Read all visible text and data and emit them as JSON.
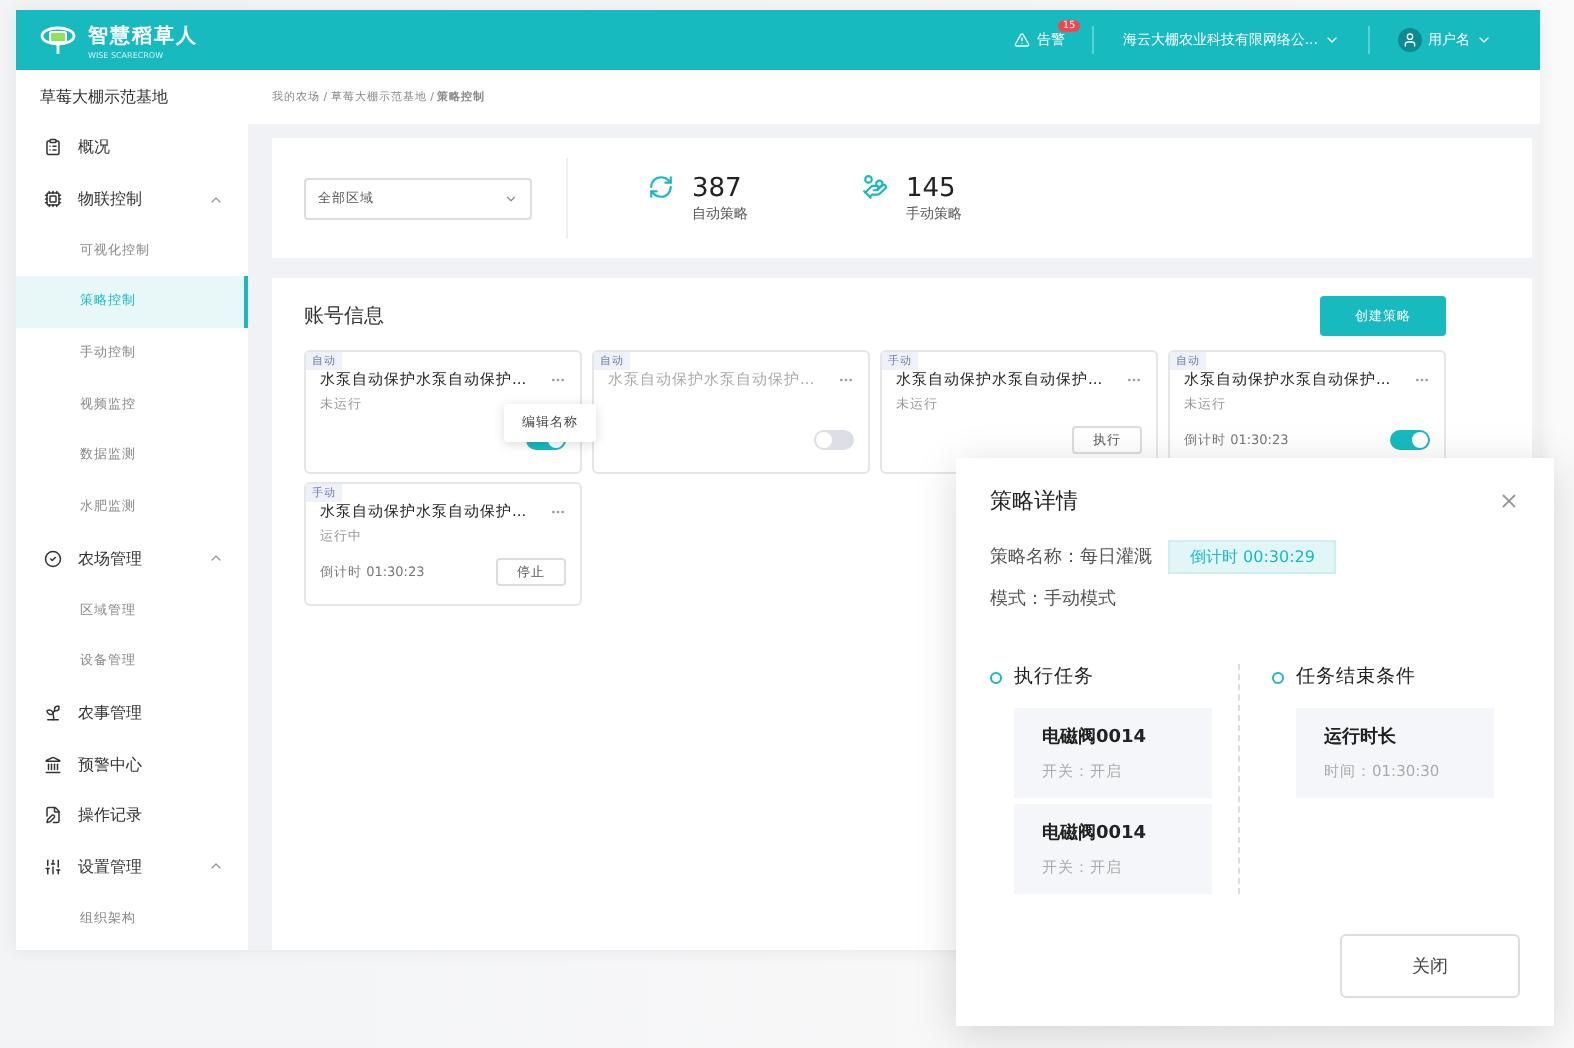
{
  "header": {
    "brand": "智慧稻草人",
    "brand_sub": "WISE SCARECROW",
    "alert": {
      "label": "告警",
      "badge": "15"
    },
    "company": "海云大棚农业科技有限网络公...",
    "user": "用户名"
  },
  "sidebar": {
    "farm": "草莓大棚示范基地",
    "items": [
      {
        "label": "概况"
      },
      {
        "label": "物联控制",
        "expanded": true,
        "children": [
          {
            "label": "可视化控制",
            "selected": false
          },
          {
            "label": "策略控制",
            "selected": true
          },
          {
            "label": "手动控制",
            "selected": false
          },
          {
            "label": "视频监控",
            "selected": false
          },
          {
            "label": "数据监测",
            "selected": false
          },
          {
            "label": "水肥监测",
            "selected": false
          }
        ]
      },
      {
        "label": "农场管理",
        "expanded": true,
        "children": [
          {
            "label": "区域管理",
            "selected": false
          },
          {
            "label": "设备管理",
            "selected": false
          }
        ]
      },
      {
        "label": "农事管理"
      },
      {
        "label": "预警中心"
      },
      {
        "label": "操作记录"
      },
      {
        "label": "设置管理",
        "expanded": true,
        "children": [
          {
            "label": "组织架构",
            "selected": false
          }
        ]
      }
    ]
  },
  "breadcrumb": "我的农场 / 草莓大棚示范基地 / **策略控制**",
  "filter": {
    "value": "全部区域"
  },
  "stats": [
    {
      "kind": "auto",
      "value": "387",
      "label": "自动策略"
    },
    {
      "kind": "manual",
      "value": "145",
      "label": "手动策略"
    }
  ],
  "section_title": "账号信息",
  "create_button": "创建策略",
  "cards": [
    {
      "tag": "自动",
      "title": "水泵自动保护水泵自动保护...",
      "status": "未运行",
      "disabled": false,
      "menu": "编辑名称",
      "control": {
        "kind": "toggle",
        "on": true
      }
    },
    {
      "tag": "自动",
      "title": "水泵自动保护水泵自动保护...",
      "disabled": true,
      "control": {
        "kind": "toggle",
        "on": false
      }
    },
    {
      "tag": "手动",
      "title": "水泵自动保护水泵自动保护...",
      "status": "未运行",
      "disabled": false,
      "control": {
        "kind": "button",
        "label": "执行"
      }
    },
    {
      "tag": "自动",
      "title": "水泵自动保护水泵自动保护...",
      "status": "未运行",
      "countdown": "倒计时 01:30:23",
      "disabled": false,
      "control": {
        "kind": "toggle",
        "on": true
      }
    },
    {
      "tag": "手动",
      "title": "水泵自动保护水泵自动保护...",
      "status": "运行中",
      "countdown": "倒计时 01:30:23",
      "disabled": false,
      "control": {
        "kind": "button",
        "label": "停止"
      }
    }
  ],
  "dialog": {
    "title": "策略详情",
    "name": "策略名称：每日灌溉",
    "countdown": "倒计时  00:30:29",
    "mode": "模式：手动模式",
    "tasks_title": "执行任务",
    "tasks": [
      {
        "name": "电磁阀0014",
        "detail": "开关：开启"
      },
      {
        "name": "电磁阀0014",
        "detail": "开关：开启"
      }
    ],
    "end_title": "任务结束条件",
    "end": [
      {
        "name": "运行时长",
        "detail": "时间：01:30:30"
      }
    ],
    "close": "关闭"
  }
}
